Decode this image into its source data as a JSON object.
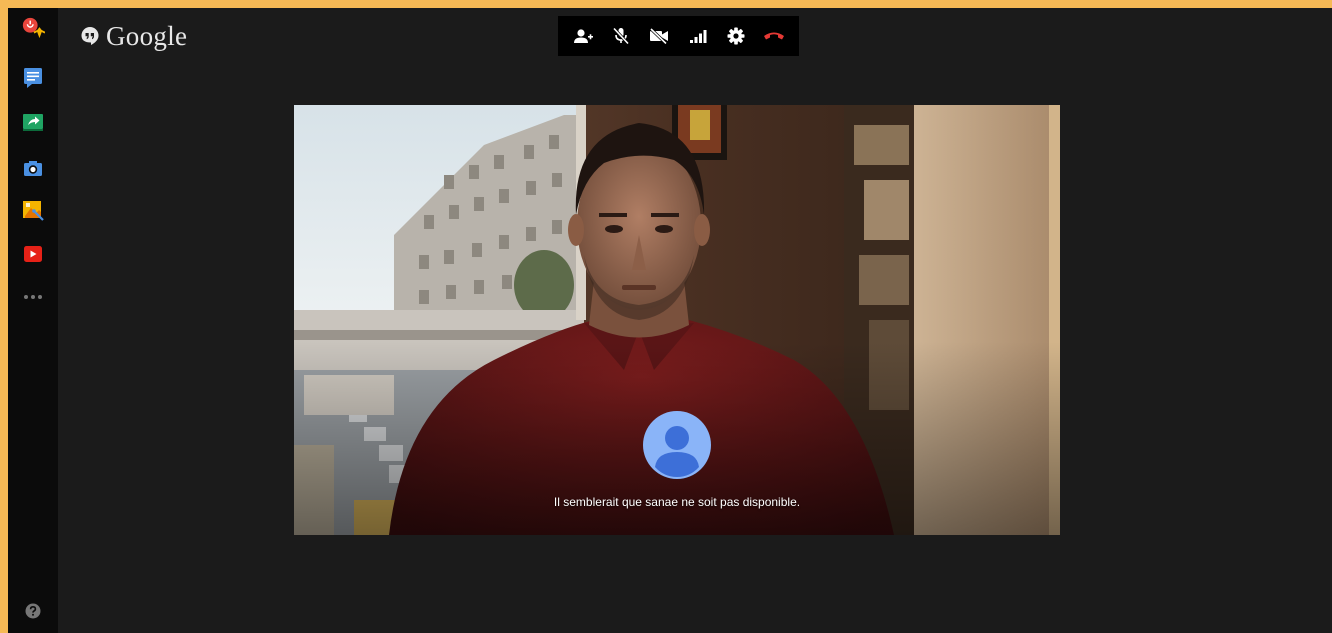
{
  "brand": {
    "name": "Google"
  },
  "rail": {
    "items": [
      {
        "name": "hangouts-profile-icon",
        "color": "#e8453c"
      },
      {
        "name": "chat-icon",
        "color": "#4a90e2"
      },
      {
        "name": "screen-share-icon",
        "color": "#1fa463"
      },
      {
        "name": "camera-icon",
        "color": "#4a90e2"
      },
      {
        "name": "effects-icon",
        "color": "#f4b400"
      },
      {
        "name": "youtube-icon",
        "color": "#e62117"
      },
      {
        "name": "more-apps-icon",
        "color": "#777777"
      }
    ],
    "help_icon": "help-icon"
  },
  "toolbar": {
    "buttons": [
      {
        "name": "invite-people-button",
        "icon": "person-add-icon"
      },
      {
        "name": "mute-microphone-button",
        "icon": "mic-off-icon"
      },
      {
        "name": "turn-off-camera-button",
        "icon": "video-off-icon"
      },
      {
        "name": "bandwidth-settings-button",
        "icon": "signal-bars-icon"
      },
      {
        "name": "settings-button",
        "icon": "gear-icon"
      },
      {
        "name": "hang-up-button",
        "icon": "hang-up-icon",
        "color": "#e53935"
      }
    ]
  },
  "call": {
    "status_message": "Il semblerait que sanae ne soit pas disponible."
  },
  "colors": {
    "accent_red": "#e53935",
    "avatar_bg": "#8ab4f8",
    "avatar_fg": "#3d6fd8"
  }
}
